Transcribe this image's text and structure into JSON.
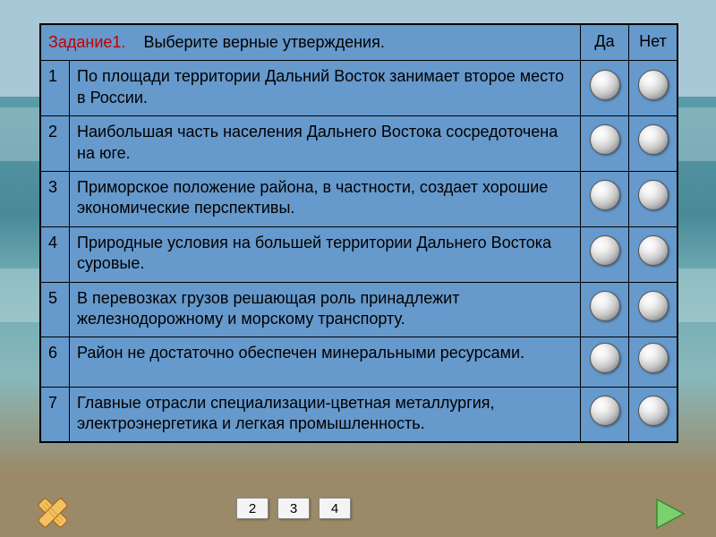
{
  "header": {
    "task_label": "Задание1.",
    "instruction": "Выберите верные утверждения.",
    "yes": "Да",
    "no": "Нет"
  },
  "rows": [
    {
      "n": "1",
      "text": "По площади территории Дальний Восток занимает второе место в России."
    },
    {
      "n": "2",
      "text": "Наибольшая часть населения Дальнего Востока сосредоточена на юге."
    },
    {
      "n": "3",
      "text": "Приморское положение района, в частности, создает хорошие экономические перспективы."
    },
    {
      "n": "4",
      "text": "Природные условия на большей территории Дальнего Востока суровые."
    },
    {
      "n": "5",
      "text": "В перевозках грузов решающая роль принадлежит железнодорожному и морскому транспорту."
    },
    {
      "n": "6",
      "text": "Район не достаточно обеспечен минеральными  ресурсами."
    },
    {
      "n": "7",
      "text": "Главные отрасли специализации-цветная металлургия, электроэнергетика и легкая промышленность."
    }
  ],
  "pager": {
    "b1": "2",
    "b2": "3",
    "b3": "4"
  },
  "colors": {
    "cell_bg": "#6699cc",
    "task_red": "#c00000"
  }
}
